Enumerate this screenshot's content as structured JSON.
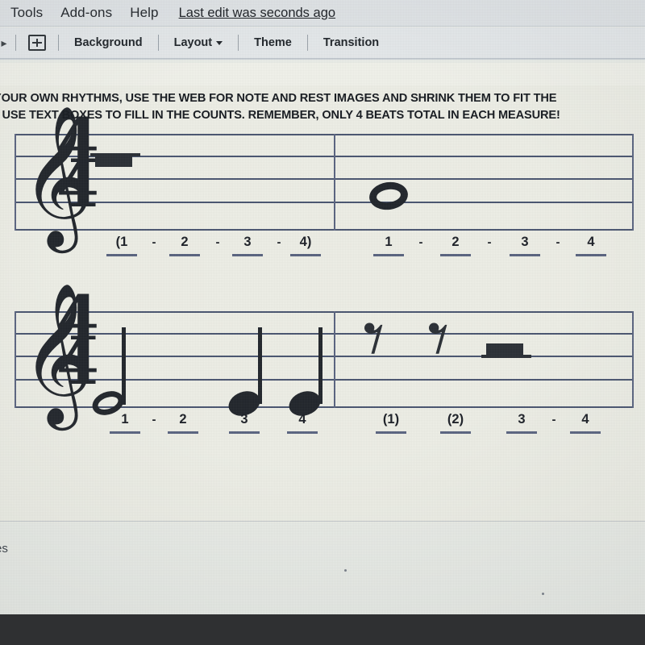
{
  "app": {
    "menubar": {
      "items": [
        "Tools",
        "Add-ons",
        "Help"
      ],
      "last_edit": "Last edit was seconds ago"
    },
    "toolbar": {
      "new_slide_icon": "new-slide-plus-icon",
      "buttons": [
        {
          "label": "Background",
          "has_caret": false
        },
        {
          "label": "Layout",
          "has_caret": true
        },
        {
          "label": "Theme",
          "has_caret": false
        },
        {
          "label": "Transition",
          "has_caret": false
        }
      ]
    }
  },
  "slide": {
    "instructions": {
      "line1": "YOUR OWN RHYTHMS, USE THE WEB FOR NOTE AND REST IMAGES AND SHRINK THEM TO FIT THE",
      "line2": "E USE TEXT BOXES TO FILL IN THE COUNTS. REMEMBER, ONLY 4 BEATS TOTAL IN EACH MEASURE!"
    },
    "systems": [
      {
        "clef": "treble-clef",
        "time_signature": {
          "top": "4",
          "bottom": "4"
        },
        "measures": [
          {
            "index": 1,
            "symbols": [
              "whole-rest"
            ],
            "counts": [
              "(1",
              "2",
              "3",
              "4)"
            ],
            "dashes": [
              "-",
              "-",
              "-"
            ]
          },
          {
            "index": 2,
            "symbols": [
              "whole-note"
            ],
            "counts": [
              "1",
              "2",
              "3",
              "4"
            ],
            "dashes": [
              "-",
              "-",
              "-"
            ]
          }
        ]
      },
      {
        "clef": "treble-clef",
        "time_signature": {
          "top": "4",
          "bottom": "4"
        },
        "measures": [
          {
            "index": 3,
            "symbols": [
              "half-note",
              "quarter-note",
              "quarter-note"
            ],
            "counts": [
              "1",
              "2",
              "3",
              "4"
            ],
            "dashes": [
              "-",
              "",
              ""
            ]
          },
          {
            "index": 4,
            "symbols": [
              "quarter-rest",
              "quarter-rest",
              "half-rest"
            ],
            "counts": [
              "(1)",
              "(2)",
              "3",
              "4"
            ],
            "dashes": [
              "",
              "",
              "-"
            ]
          }
        ]
      }
    ],
    "bottom_text_fragment": "es"
  },
  "colors": {
    "staff_line": "#4a5570",
    "note_ink": "#22262c",
    "count_rule": "#5a6480",
    "menubar_bg": "#dfe3e6",
    "toolbar_bg": "#e4e8ea",
    "slide_bg": "#edeee6",
    "bottom_bar": "#2f3032"
  }
}
